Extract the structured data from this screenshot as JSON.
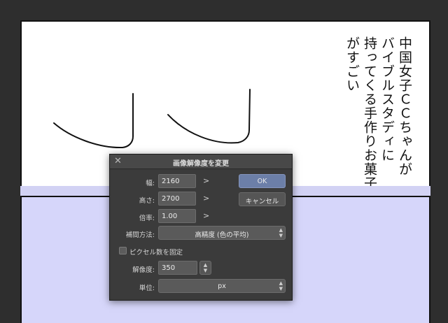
{
  "manga": {
    "vertical_lines": [
      "中国女子ＣＣちゃんが",
      "バイブルスタディに",
      "持ってくる手作りお菓子",
      "がすごい"
    ]
  },
  "dialog": {
    "title": "画像解像度を変更",
    "close_icon": "close-icon",
    "width_label": "幅:",
    "width_value": "2160",
    "height_label": "高さ:",
    "height_value": "2700",
    "scale_label": "倍率:",
    "scale_value": "1.00",
    "arrow_glyph": ">",
    "interp_label": "補間方法:",
    "interp_value": "高精度 (色の平均)",
    "fix_pixels_label": "ピクセル数を固定",
    "fix_pixels_checked": false,
    "resolution_label": "解像度:",
    "resolution_value": "350",
    "unit_label": "単位:",
    "unit_value": "px",
    "ok_label": "OK",
    "cancel_label": "キャンセル"
  },
  "colors": {
    "canvas_bg": "#2e2e2e",
    "panel_bottom": "#d6d6fa",
    "ok_button": "#6c7fa8",
    "dialog_bg": "#3b3b3b"
  }
}
